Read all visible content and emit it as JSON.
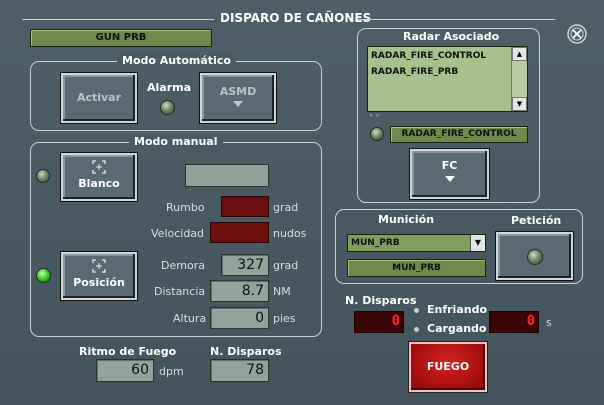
{
  "window": {
    "title": "DISPARO DE CAÑONES",
    "gun_name": "GUN PRB"
  },
  "auto": {
    "title": "Modo Automático",
    "activar_label": "Activar",
    "alarma_label": "Alarma",
    "asmd_label": "ASMD"
  },
  "manual": {
    "title": "Modo manual",
    "blanco_label": "Blanco",
    "posicion_label": "Posición",
    "blank_field": "",
    "rumbo_label": "Rumbo",
    "rumbo_unit": "grad",
    "velocidad_label": "Velocidad",
    "velocidad_unit": "nudos",
    "demora_label": "Demora",
    "demora_value": "327",
    "demora_unit": "grad",
    "distancia_label": "Distancia",
    "distancia_value": "8.7",
    "distancia_unit": "NM",
    "altura_label": "Altura",
    "altura_value": "0",
    "altura_unit": "pies"
  },
  "bottom": {
    "ritmo_label": "Ritmo de Fuego",
    "ritmo_value": "60",
    "ritmo_unit": "dpm",
    "ndisp_label": "N. Disparos",
    "ndisp_value": "78"
  },
  "radar": {
    "title": "Radar Asociado",
    "items": [
      "RADAR_FIRE_CONTROL",
      "RADAR_FIRE_PRB"
    ],
    "selected": "RADAR_FIRE_CONTROL",
    "fc_label": "FC",
    "ticks": "° °"
  },
  "municion": {
    "title": "Munición",
    "select_value": "MUN_PRB",
    "current": "MUN_PRB",
    "peticion_label": "Petición"
  },
  "fire": {
    "ndisp_label": "N. Disparos",
    "ndisp_value": "0",
    "enfriando_label": "Enfriando",
    "cargando_label": "Cargando",
    "timer_value": "0",
    "timer_unit": "s",
    "fuego_label": "FUEGO"
  },
  "colors": {
    "background": "#46565e",
    "panel_green": "#6d8a4a",
    "led_green": "#3ad42a",
    "fuego_red": "#b01010"
  },
  "icons": {
    "close": "close-icon",
    "target": "crosshair-icon",
    "chevron": "chevron-down-icon"
  }
}
